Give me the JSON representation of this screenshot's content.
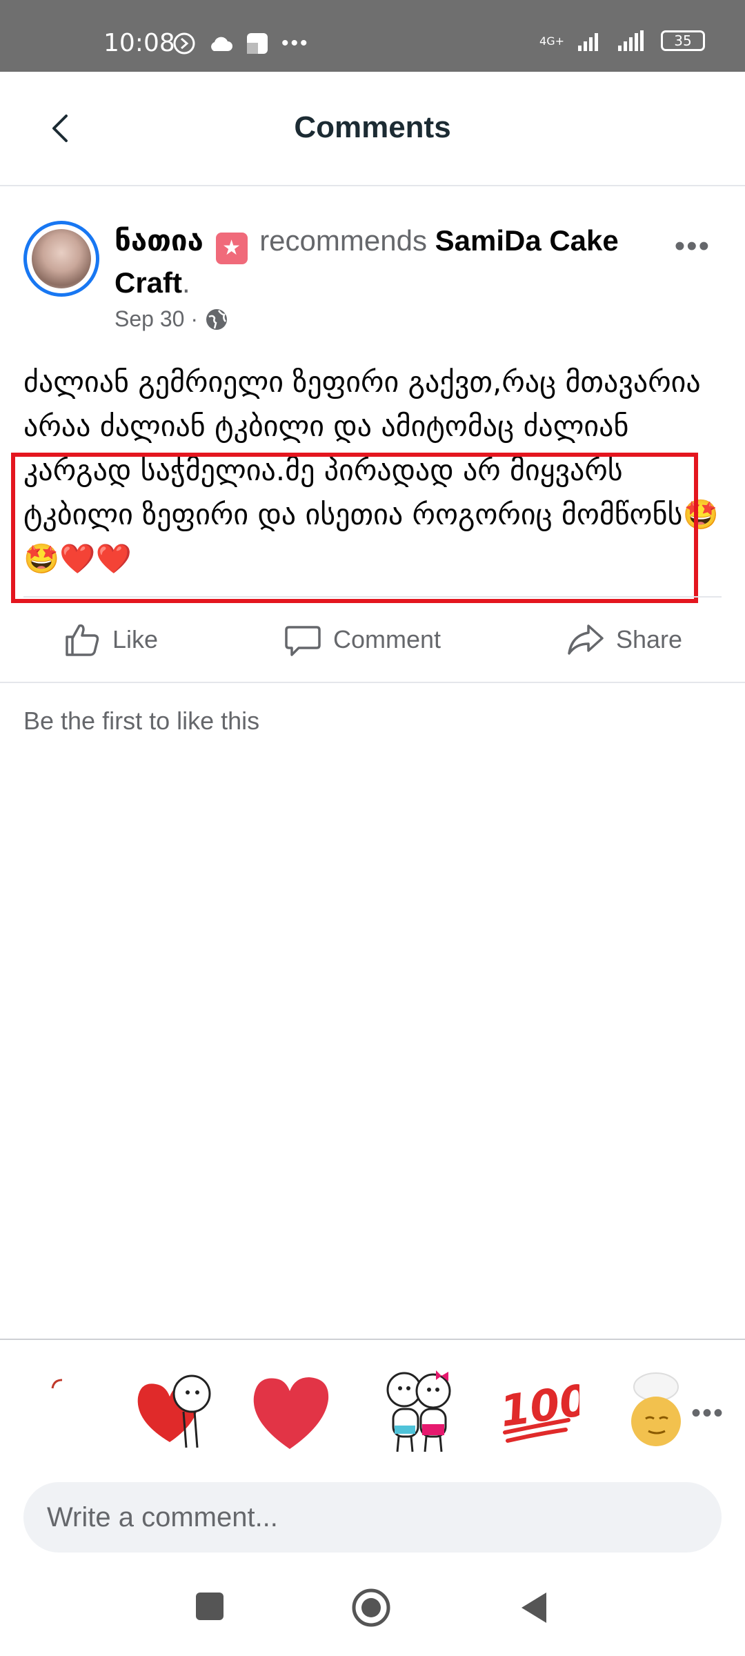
{
  "status_bar": {
    "time": "10:08",
    "network": "4G+",
    "battery": "35"
  },
  "header": {
    "title": "Comments"
  },
  "post": {
    "author": "ნათია",
    "recommends_text": " recommends ",
    "page_name": "SamiDa Cake Craft",
    "page_suffix": ".",
    "date": "Sep 30 ·",
    "body": "ძალიან გემრიელი ზეფირი გაქვთ,რაც მთავარია არაა ძალიან ტკბილი და ამიტომაც ძალიან კარგად საჭმელია.მე პირადად არ მიყვარს ტკბილი ზეფირი და ისეთია როგორიც მომწონს🤩🤩❤️❤️"
  },
  "actions": {
    "like": "Like",
    "comment": "Comment",
    "share": "Share"
  },
  "likes_text": "Be the first to like this",
  "stickers": {
    "hundred": "100"
  },
  "comment_input": {
    "placeholder": "Write a comment..."
  },
  "colors": {
    "accent": "#1877f2",
    "highlight": "#e4161f",
    "status_bar": "#6f6f6f"
  }
}
